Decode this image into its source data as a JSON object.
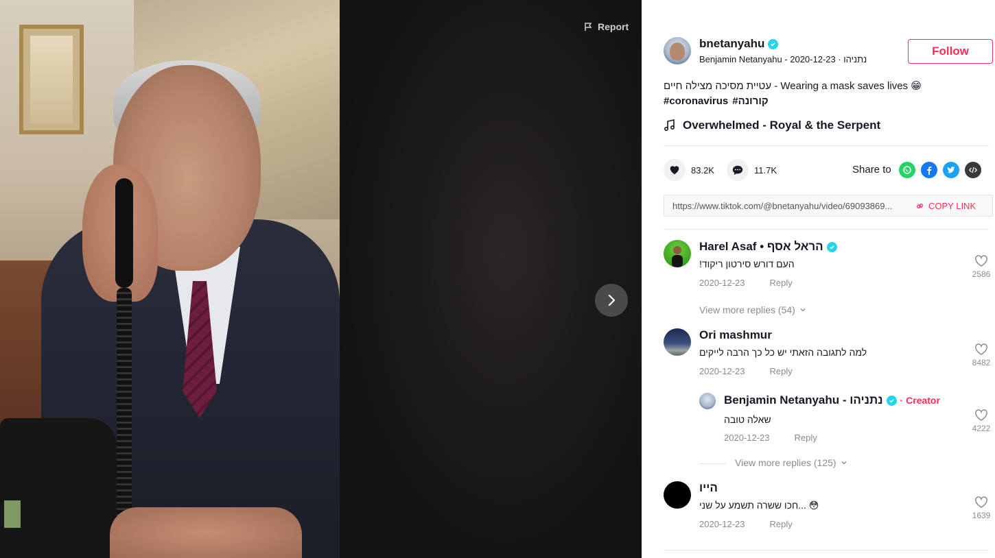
{
  "video": {
    "report_label": "Report"
  },
  "author": {
    "username": "bnetanyahu",
    "subline": "Benjamin Netanyahu - 2020-12-23 · נתניהו",
    "follow_label": "Follow"
  },
  "caption": {
    "text": "עטיית מסיכה מצילה חיים - Wearing a mask saves lives 😁",
    "tags": [
      "#coronavirus",
      "#קורונה"
    ],
    "music": "Overwhelmed - Royal & the Serpent"
  },
  "stats": {
    "likes": "83.2K",
    "comments": "11.7K",
    "share_label": "Share to"
  },
  "share_colors": {
    "whatsapp": "#25d366",
    "facebook": "#1877f2",
    "twitter": "#1da1f2",
    "embed": "#3a3a3a"
  },
  "link": {
    "url": "https://www.tiktok.com/@bnetanyahu/video/69093869...",
    "copy_label": "COPY LINK"
  },
  "comments": [
    {
      "name": "Harel Asaf • הראל אסף",
      "text": "!העם דורש סירטון ריקוד",
      "date": "2020-12-23",
      "reply_label": "Reply",
      "likes": "2586",
      "view_more": "View more replies (54)"
    },
    {
      "name": "Ori mashmur",
      "text": "למה לתגובה הזאתי יש כל כך הרבה לייקים",
      "date": "2020-12-23",
      "reply_label": "Reply",
      "likes": "8482",
      "reply": {
        "name": "Benjamin Netanyahu - נתניהו",
        "creator_label": "· Creator",
        "text": "שאלה טובה",
        "date": "2020-12-23",
        "reply_label": "Reply",
        "likes": "4222"
      },
      "view_more": "View more replies (125)"
    },
    {
      "name": "הייו",
      "text": "חכו ששרה תשמע על שני... 😳",
      "date": "2020-12-23",
      "reply_label": "Reply",
      "likes": "1639"
    }
  ]
}
